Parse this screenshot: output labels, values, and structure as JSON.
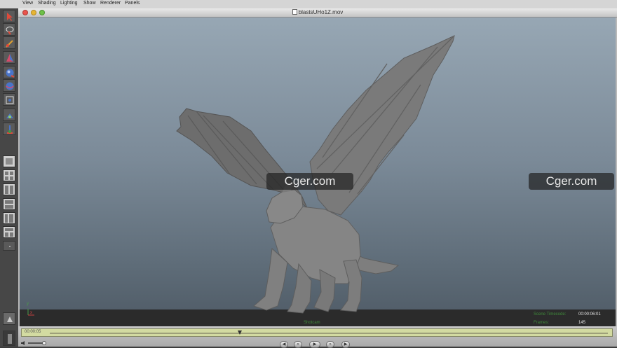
{
  "menu": {
    "items": [
      {
        "label": "View"
      },
      {
        "label": "Shading"
      },
      {
        "label": "Lighting"
      },
      {
        "label": "Show"
      },
      {
        "label": "Renderer"
      },
      {
        "label": "Panels"
      }
    ]
  },
  "player": {
    "title": "blastsUHo1Z.mov",
    "current_time": "00:00:05",
    "progress": 0.34
  },
  "viewport": {
    "camera_name": "Shotcam",
    "scene_timecode_label": "Scene Timecode:",
    "scene_timecode_value": "00:00:06:01",
    "frames_label": "Frames:",
    "frames_value": "145",
    "axis_labels": {
      "y": "y",
      "x": "x"
    }
  },
  "watermarks": [
    {
      "text": "Cger.com"
    },
    {
      "text": "Cger.com"
    }
  ],
  "colors": {
    "hud_green": "#3f8a3a",
    "hud_white": "#e8e8e8",
    "scrubber": "#d3dba1",
    "dragon": "#7d7d7d"
  },
  "icons": [
    "select-tool-icon",
    "lasso-tool-icon",
    "paint-select-icon",
    "move-tool-icon",
    "rotate-tool-icon",
    "scale-tool-icon",
    "manipulator-icon",
    "soft-mod-icon",
    "show-manip-icon"
  ]
}
